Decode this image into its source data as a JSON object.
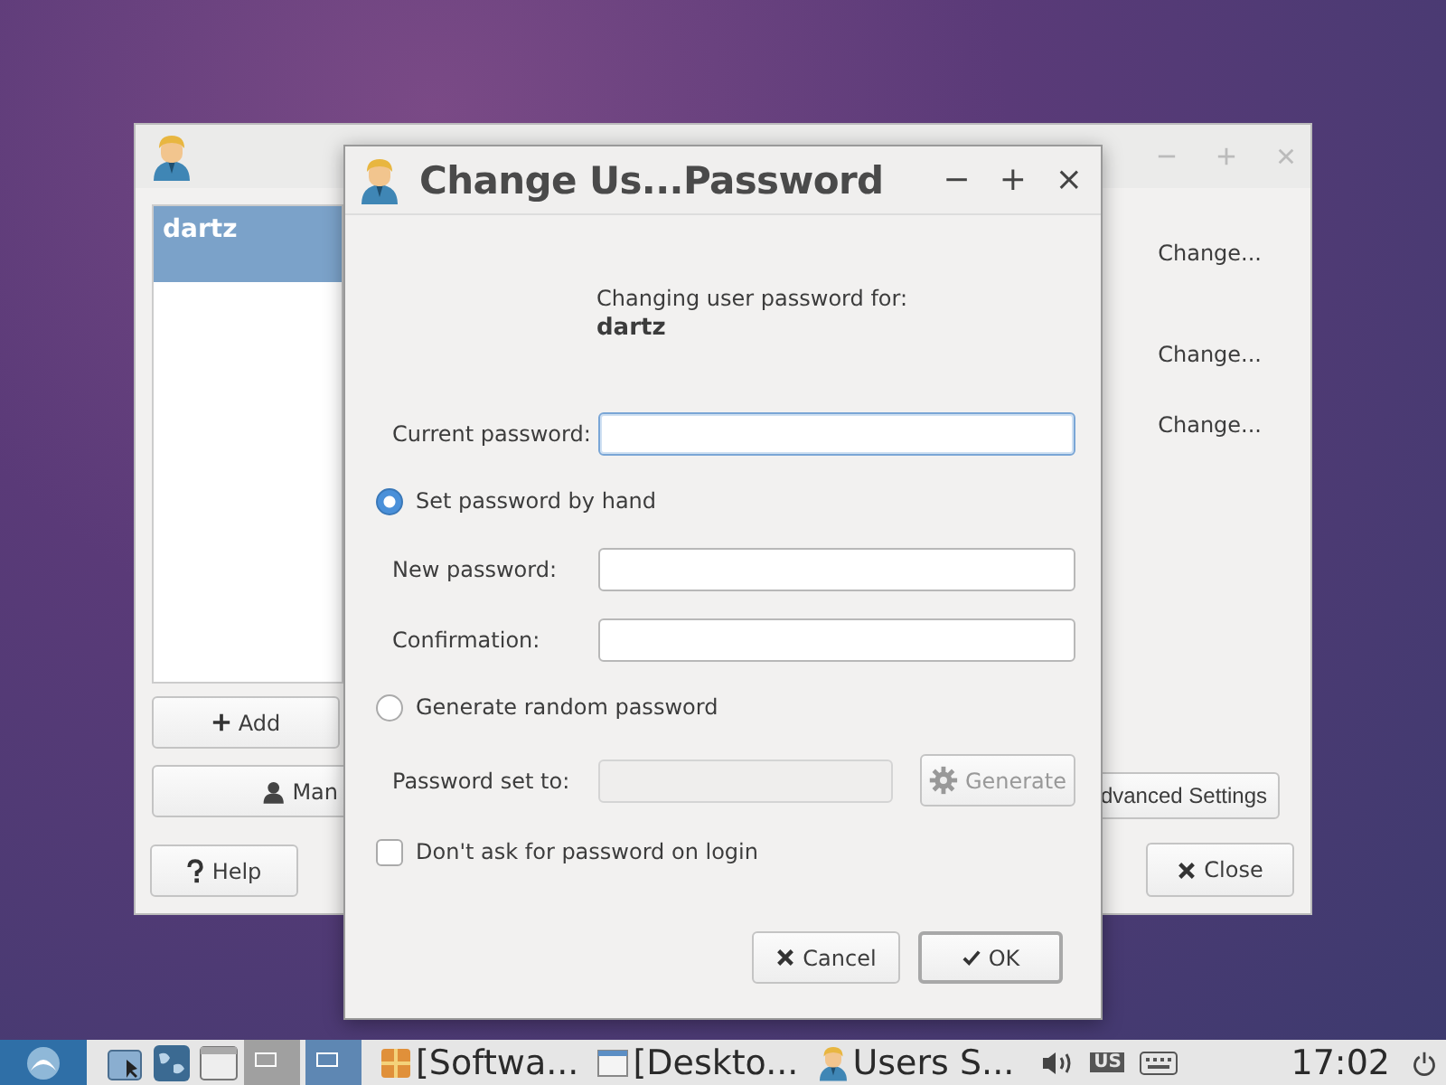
{
  "background_window": {
    "list_items": [
      {
        "label": "dartz",
        "selected": true
      }
    ],
    "add_button": "Add",
    "manage_button": "Man",
    "help_button": "Help",
    "change_links": [
      "Change...",
      "Change...",
      "Change..."
    ],
    "advanced_button": "dvanced Settings",
    "close_button": "Close"
  },
  "dialog": {
    "title": "Change Us...Password",
    "minimize": "−",
    "maximize": "+",
    "close": "×",
    "intro": "Changing user password for:",
    "user": "dartz",
    "current_password": {
      "label": "Current password:",
      "focused": true
    },
    "modes": [
      {
        "label": "Set password by hand",
        "selected": true
      },
      {
        "label": "Generate random password",
        "selected": false
      }
    ],
    "new_password": {
      "label": "New password:"
    },
    "confirmation": {
      "label": "Confirmation:"
    },
    "password_set_to": {
      "label": "Password set to:",
      "disabled": true
    },
    "generate_button": {
      "label": "Generate",
      "disabled": true
    },
    "no_password_login": {
      "label": "Don't ask for password on login",
      "checked": false
    },
    "cancel_button": "Cancel",
    "ok_button": "OK"
  },
  "taskbar": {
    "workspaces": [
      {
        "selected": false
      },
      {
        "selected": true
      }
    ],
    "tasks": [
      {
        "label": "[Softwa...",
        "kind": "package"
      },
      {
        "label": "[Deskto...",
        "kind": "window"
      },
      {
        "label": "Users S...",
        "kind": "user"
      }
    ],
    "keyboard_layout": "US",
    "clock": "17:02"
  }
}
